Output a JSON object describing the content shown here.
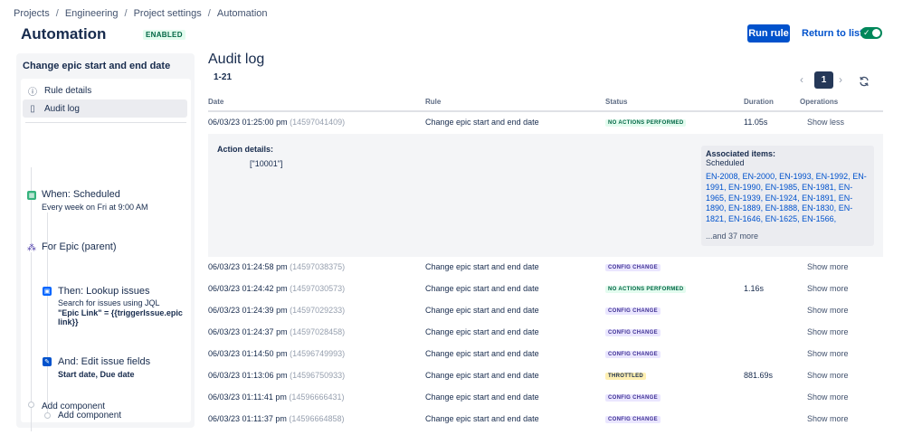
{
  "breadcrumb": [
    "Projects",
    "Engineering",
    "Project settings",
    "Automation"
  ],
  "page_title": "Automation",
  "enabled_badge": "ENABLED",
  "run_rule": "Run rule",
  "return_to_list": "Return to list",
  "toggle_check": "✓",
  "left": {
    "rule_name": "Change epic start and end date",
    "nav": [
      {
        "label": "Rule details",
        "icon": "info-icon",
        "glyph": "ⓘ"
      },
      {
        "label": "Audit log",
        "icon": "document-icon",
        "glyph": "▯"
      }
    ],
    "trigger": {
      "title": "When: Scheduled",
      "sub": "Every week on Fri at 9:00 AM"
    },
    "branch": {
      "title": "For Epic (parent)"
    },
    "lookup": {
      "title": "Then: Lookup issues",
      "sub1": "Search for issues using JQL",
      "sub2": "\"Epic Link\" = {{triggerIssue.epic",
      "sub3": "link}}"
    },
    "edit": {
      "title": "And: Edit issue fields",
      "sub": "Start date, Due date"
    },
    "add_component_inner": "Add component",
    "add_component_outer": "Add component"
  },
  "audit": {
    "title": "Audit log",
    "range": "1-21",
    "page": "1",
    "prev": "‹",
    "next": "›",
    "columns": [
      "Date",
      "Rule",
      "Status",
      "Duration",
      "Operations"
    ],
    "rows": [
      {
        "date": "06/03/23 01:25:00 pm",
        "id": "(14597041409)",
        "rule": "Change epic start and end date",
        "status": "NO ACTIONS PERFORMED",
        "status_kind": "no",
        "duration": "11.05s",
        "op": "Show less"
      },
      {
        "date": "06/03/23 01:24:58 pm",
        "id": "(14597038375)",
        "rule": "Change epic start and end date",
        "status": "CONFIG CHANGE",
        "status_kind": "config",
        "duration": "",
        "op": "Show more"
      },
      {
        "date": "06/03/23 01:24:42 pm",
        "id": "(14597030573)",
        "rule": "Change epic start and end date",
        "status": "NO ACTIONS PERFORMED",
        "status_kind": "no",
        "duration": "1.16s",
        "op": "Show more"
      },
      {
        "date": "06/03/23 01:24:39 pm",
        "id": "(14597029233)",
        "rule": "Change epic start and end date",
        "status": "CONFIG CHANGE",
        "status_kind": "config",
        "duration": "",
        "op": "Show more"
      },
      {
        "date": "06/03/23 01:24:37 pm",
        "id": "(14597028458)",
        "rule": "Change epic start and end date",
        "status": "CONFIG CHANGE",
        "status_kind": "config",
        "duration": "",
        "op": "Show more"
      },
      {
        "date": "06/03/23 01:14:50 pm",
        "id": "(14596749993)",
        "rule": "Change epic start and end date",
        "status": "CONFIG CHANGE",
        "status_kind": "config",
        "duration": "",
        "op": "Show more"
      },
      {
        "date": "06/03/23 01:13:06 pm",
        "id": "(14596750933)",
        "rule": "Change epic start and end date",
        "status": "THROTTLED",
        "status_kind": "thr",
        "duration": "881.69s",
        "op": "Show more"
      },
      {
        "date": "06/03/23 01:11:41 pm",
        "id": "(14596666431)",
        "rule": "Change epic start and end date",
        "status": "CONFIG CHANGE",
        "status_kind": "config",
        "duration": "",
        "op": "Show more"
      },
      {
        "date": "06/03/23 01:11:37 pm",
        "id": "(14596664858)",
        "rule": "Change epic start and end date",
        "status": "CONFIG CHANGE",
        "status_kind": "config",
        "duration": "",
        "op": "Show more"
      }
    ],
    "details": {
      "label": "Action details:",
      "value": "[\"10001\"]",
      "assoc_title": "Associated items:",
      "assoc_sub": "Scheduled",
      "items": [
        "EN-2008",
        "EN-2000",
        "EN-1993",
        "EN-1992",
        "EN-1991",
        "EN-1990",
        "EN-1985",
        "EN-1981",
        "EN-1965",
        "EN-1939",
        "EN-1924",
        "EN-1891",
        "EN-1890",
        "EN-1889",
        "EN-1888",
        "EN-1830",
        "EN-1821",
        "EN-1646",
        "EN-1625",
        "EN-1566"
      ],
      "more": "...and 37 more"
    }
  },
  "colors": {
    "primary": "#0052cc",
    "toggle_on": "#00875a",
    "pager_active": "#253858"
  }
}
